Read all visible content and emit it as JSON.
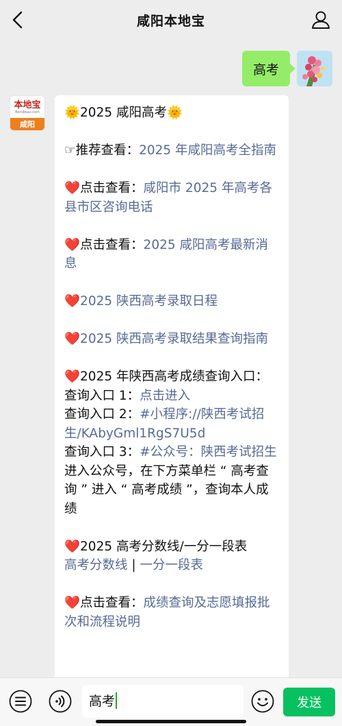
{
  "nav": {
    "title": "咸阳本地宝"
  },
  "outgoing": {
    "text": "高考"
  },
  "bot_avatar": {
    "logo_text": "本地宝",
    "url_text": "Bendibao.com",
    "city": "咸阳"
  },
  "reply": {
    "header": "🌞2025 咸阳高考🌞",
    "item1_prefix": "☞推荐查看：",
    "item1_link": "2025 年咸阳高考全指南",
    "item2_prefix": "❤️点击查看：",
    "item2_link": "咸阳市 2025 年高考各县市区咨询电话",
    "item3_prefix": "❤️点击查看：",
    "item3_link": "2025 咸阳高考最新消息",
    "item4_heart": "❤️",
    "item4_link": "2025 陕西高考录取日程",
    "item5_heart": "❤️",
    "item5_link": "2025 陕西高考录取结果查询指南",
    "item6_title": "❤️2025 年陕西高考成绩查询入口：",
    "entry1_label": "查询入口 1：",
    "entry1_link": "点击进入",
    "entry2_label": "查询入口 2：",
    "entry2_link": "#小程序://陕西考试招生/KAbyGml1RgS7U5d",
    "entry3_label": "查询入口 3：",
    "entry3_link": "#公众号：陕西考试招生",
    "entry_note": "进入公众号，在下方菜单栏 “ 高考查询 ” 进入 “ 高考成绩 ”，查询本人成绩",
    "item7_title": "❤️2025 高考分数线/一分一段表",
    "item7_link_a": "高考分数线",
    "item7_sep": " | ",
    "item7_link_b": "一分一段表",
    "item8_prefix": "❤️点击查看：",
    "item8_link": "成绩查询及志愿填报批次和流程说明"
  },
  "input_bar": {
    "value": "高考",
    "send_label": "发送"
  },
  "colors": {
    "bubble_out": "#95ec69",
    "link": "#576b95",
    "send": "#07c160",
    "bot_orange": "#ee7f1f"
  }
}
